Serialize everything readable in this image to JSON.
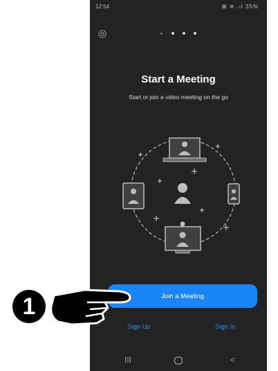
{
  "status_bar": {
    "time": "12:54",
    "indicators": "⊠ ≋ .ıl 35%"
  },
  "onboarding": {
    "title": "Start a Meeting",
    "subtitle": "Start or join a video meeting on the go",
    "page_indicator": {
      "total": 4,
      "active": 1
    },
    "settings_icon": "gear-icon"
  },
  "actions": {
    "join_label": "Join a Meeting",
    "sign_up_label": "Sign Up",
    "sign_in_label": "Sign In"
  },
  "navbar": {
    "recent": "III",
    "home": "home-icon",
    "back": "<"
  },
  "annotation": {
    "step_number": "1"
  },
  "colors": {
    "accent": "#1a85f4",
    "link": "#2d8cff",
    "background": "#232323"
  }
}
